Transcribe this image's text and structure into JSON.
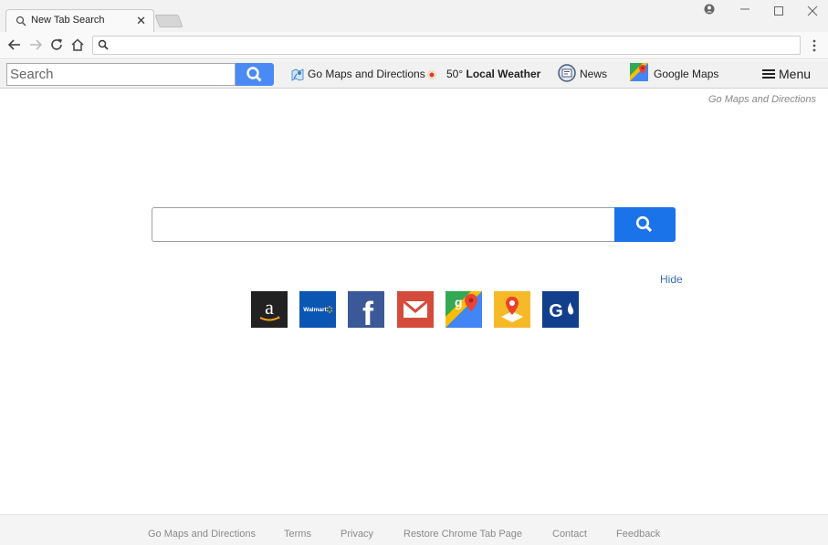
{
  "browser": {
    "tab_title": "New Tab Search",
    "tab_close": "✕",
    "address_value": ""
  },
  "toolbar": {
    "search_placeholder": "Search",
    "maps_directions_label": "Go Maps and Directions",
    "weather_temp": "50°",
    "weather_label": "Local Weather",
    "news_label": "News",
    "google_maps_label": "Google Maps",
    "menu_label": "Menu"
  },
  "main": {
    "brand_text": "Go Maps and Directions",
    "hide_label": "Hide",
    "tiles": [
      {
        "name": "amazon",
        "icon": "amazon-icon"
      },
      {
        "name": "walmart",
        "icon": "walmart-icon",
        "text": "Walmart"
      },
      {
        "name": "facebook",
        "icon": "facebook-icon",
        "text": "f"
      },
      {
        "name": "gmail",
        "icon": "gmail-icon"
      },
      {
        "name": "google-maps",
        "icon": "google-maps-icon"
      },
      {
        "name": "maps-directions",
        "icon": "directions-icon"
      },
      {
        "name": "g-app",
        "icon": "g-app-icon",
        "text": "G"
      }
    ]
  },
  "footer": {
    "links": [
      "Go Maps and Directions",
      "Terms",
      "Privacy",
      "Restore Chrome Tab Page",
      "Contact",
      "Feedback"
    ]
  },
  "colors": {
    "search_button": "#4a8af4",
    "main_search_button": "#1a73e8",
    "hide_link": "#3a6fb4"
  }
}
